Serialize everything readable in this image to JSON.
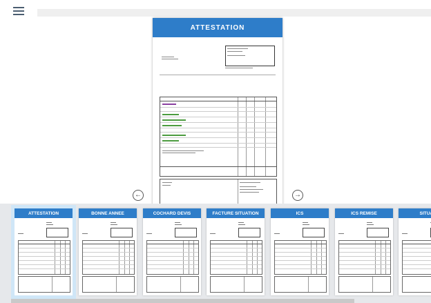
{
  "toolbar": {
    "menu_icon": "hamburger-menu-icon"
  },
  "preview": {
    "title": "ATTESTATION",
    "prev_icon": "arrow-left-circle-icon",
    "next_icon": "arrow-right-circle-icon",
    "prev_glyph": "←",
    "next_glyph": "→"
  },
  "templates": [
    {
      "label": "ATTESTATION",
      "selected": true
    },
    {
      "label": "BONNE ANNEE",
      "selected": false
    },
    {
      "label": "COCHARD DEVIS",
      "selected": false
    },
    {
      "label": "FACTURE SITUATION",
      "selected": false
    },
    {
      "label": "ICS",
      "selected": false
    },
    {
      "label": "ICS REMISE",
      "selected": false
    },
    {
      "label": "SITUAT",
      "selected": false
    }
  ],
  "colors": {
    "accent": "#2e7dc9",
    "selected_outline": "#cfe6f7",
    "strip_bg": "#e6e8eb"
  }
}
